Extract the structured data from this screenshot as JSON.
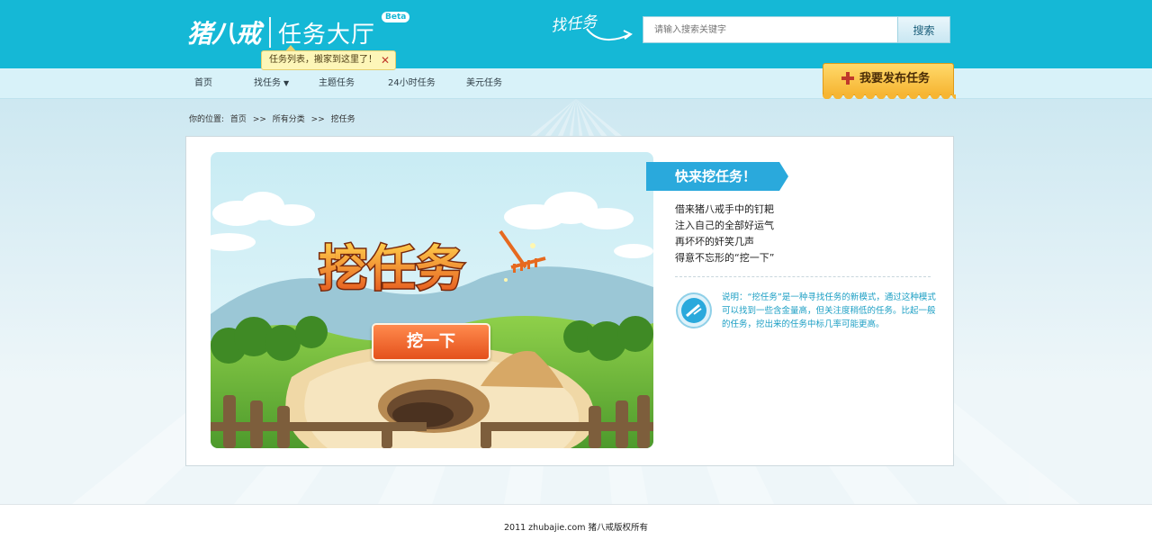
{
  "header": {
    "brand": "猪八戒",
    "title": "任务大厅",
    "beta": "Beta",
    "find_hint": "找任务",
    "search_placeholder": "请输入搜索关键字",
    "search_button": "搜索"
  },
  "nav": {
    "items": [
      {
        "label": "首页"
      },
      {
        "label": "找任务"
      },
      {
        "label": "主题任务"
      },
      {
        "label": "24小时任务"
      },
      {
        "label": "美元任务"
      }
    ],
    "tooltip": "任务列表，搬家到这里了！",
    "publish_button": "我要发布任务"
  },
  "breadcrumb": {
    "label": "你的位置:",
    "items": [
      "首页",
      "所有分类",
      "挖任务"
    ],
    "separator": ">>"
  },
  "main": {
    "scene_title": "挖任务",
    "dig_button": "挖一下",
    "ribbon": "快来挖任务！",
    "poem": [
      "借来猪八戒手中的钉耙",
      "注入自己的全部好运气",
      "再坏坏的奸笑几声",
      "得意不忘形的“挖一下”"
    ],
    "tip": "说明：“挖任务”是一种寻找任务的新模式，通过这种模式可以找到一些含金量高，但关注度稍低的任务。比起一般的任务，挖出来的任务中标几率可能更高。"
  },
  "footer": {
    "copyright": "2011  zhubajie.com   猪八戒版权所有"
  },
  "colors": {
    "header_bg": "#15b8d6",
    "nav_bg": "#d8f2f9",
    "accent_orange": "#e4511c",
    "ribbon_blue": "#2aa9dc",
    "tip_text": "#1c9fc4"
  }
}
